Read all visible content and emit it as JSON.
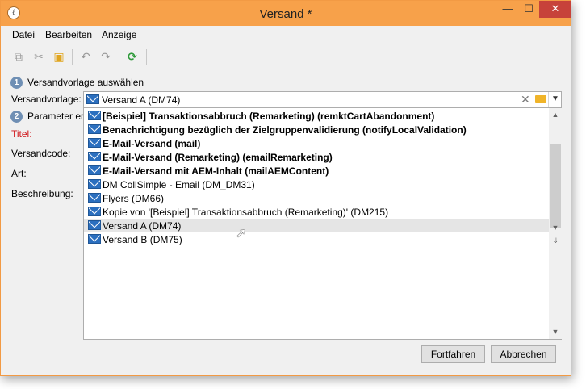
{
  "window": {
    "title": "Versand *",
    "app_icon": "app-logo-icon",
    "controls": {
      "minimize": "—",
      "maximize": "☐",
      "close": "✕"
    }
  },
  "menu": {
    "file": "Datei",
    "edit": "Bearbeiten",
    "view": "Anzeige"
  },
  "toolbar": {
    "icons": [
      "copy-icon",
      "cut-icon",
      "paste-icon",
      "undo-icon",
      "redo-icon",
      "refresh-icon"
    ]
  },
  "form": {
    "step1_number": "1",
    "step1_label": "Versandvorlage auswählen",
    "template_label": "Versandvorlage:",
    "step2_number": "2",
    "step2_label": "Parameter er",
    "title_label": "Titel:",
    "code_label": "Versandcode:",
    "type_label": "Art:",
    "description_label": "Beschreibung:"
  },
  "combo": {
    "selected_value": "Versand A (DM74)",
    "icons": [
      "email-icon",
      "clear-icon",
      "folder-icon",
      "chevron-down-icon"
    ]
  },
  "dropdown": {
    "items": [
      {
        "label": "[Beispiel] Transaktionsabbruch (Remarketing) (remktCartAbandonment)",
        "bold": true
      },
      {
        "label": "Benachrichtigung bezüglich der Zielgruppenvalidierung (notifyLocalValidation)",
        "bold": true
      },
      {
        "label": "E-Mail-Versand (mail)",
        "bold": true
      },
      {
        "label": "E-Mail-Versand (Remarketing) (emailRemarketing)",
        "bold": true
      },
      {
        "label": "E-Mail-Versand mit AEM-Inhalt (mailAEMContent)",
        "bold": true
      },
      {
        "label": "DM CollSimple - Email (DM_DM31)",
        "bold": false
      },
      {
        "label": "Flyers (DM66)",
        "bold": false
      },
      {
        "label": "Kopie von '[Beispiel] Transaktionsabbruch (Remarketing)' (DM215)",
        "bold": false
      },
      {
        "label": "Versand A (DM74)",
        "bold": false,
        "hovered": true
      },
      {
        "label": "Versand B (DM75)",
        "bold": false
      }
    ]
  },
  "buttons": {
    "continue": "Fortfahren",
    "cancel": "Abbrechen"
  },
  "colors": {
    "titlebar": "#f7a14a",
    "required_label": "#d0161b",
    "step_badge": "#6f8fb4",
    "close_button": "#c7423a"
  }
}
